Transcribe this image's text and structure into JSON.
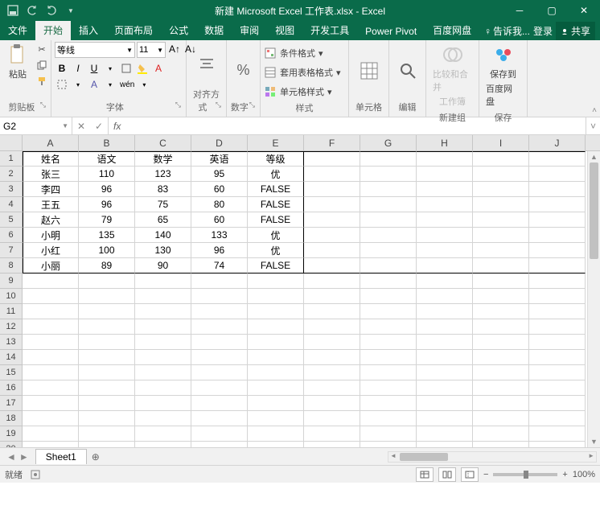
{
  "title": "新建 Microsoft Excel 工作表.xlsx - Excel",
  "tabs": [
    "文件",
    "开始",
    "插入",
    "页面布局",
    "公式",
    "数据",
    "审阅",
    "视图",
    "开发工具",
    "Power Pivot",
    "百度网盘"
  ],
  "active_tab": 1,
  "tell_me": "告诉我...",
  "login": "登录",
  "share": "共享",
  "ribbon": {
    "clipboard": {
      "paste": "粘贴",
      "label": "剪贴板"
    },
    "font": {
      "name": "等线",
      "size": "11",
      "label": "字体",
      "biu": [
        "B",
        "I",
        "U"
      ],
      "wen": "wén"
    },
    "align": {
      "label": "对齐方式"
    },
    "number": {
      "label": "数字",
      "pct": "%"
    },
    "styles": {
      "cond": "条件格式",
      "table": "套用表格格式",
      "cell": "单元格样式",
      "label": "样式"
    },
    "cells": {
      "label": "单元格"
    },
    "editing": {
      "label": "编辑"
    },
    "newgroup": {
      "compare": "比较和合并",
      "compare2": "工作簿",
      "label": "新建组"
    },
    "save": {
      "save": "保存到",
      "save2": "百度网盘",
      "label": "保存"
    }
  },
  "namebox": "G2",
  "fx": "fx",
  "columns": [
    "A",
    "B",
    "C",
    "D",
    "E",
    "F",
    "G",
    "H",
    "I",
    "J"
  ],
  "row_count": 20,
  "data": [
    [
      "姓名",
      "语文",
      "数学",
      "英语",
      "等级"
    ],
    [
      "张三",
      "110",
      "123",
      "95",
      "优"
    ],
    [
      "李四",
      "96",
      "83",
      "60",
      "FALSE"
    ],
    [
      "王五",
      "96",
      "75",
      "80",
      "FALSE"
    ],
    [
      "赵六",
      "79",
      "65",
      "60",
      "FALSE"
    ],
    [
      "小明",
      "135",
      "140",
      "133",
      "优"
    ],
    [
      "小红",
      "100",
      "130",
      "96",
      "优"
    ],
    [
      "小丽",
      "89",
      "90",
      "74",
      "FALSE"
    ]
  ],
  "sheet": "Sheet1",
  "status": "就绪",
  "zoom": "100%"
}
